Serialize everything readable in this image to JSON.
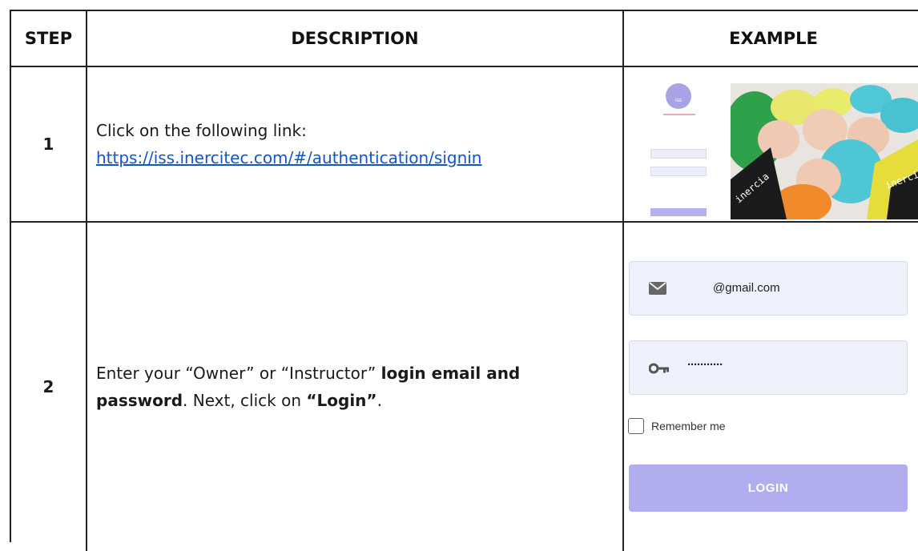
{
  "headers": {
    "step": "STEP",
    "description": "DESCRIPTION",
    "example": "EXAMPLE"
  },
  "rows": [
    {
      "step": "1",
      "text_before": "Click on the following link:",
      "link": "https://iss.inercitec.com/#/authentication/signin",
      "example_thumb": {
        "logo_text": "iss",
        "photo_caption": "inercia i.d.s"
      }
    },
    {
      "step": "2",
      "text_a": "Enter your “Owner” or “Instructor” ",
      "text_bold": "login email and password",
      "text_b": ". Next, click on ",
      "text_bold2": "“Login”",
      "text_c": ".",
      "example_form": {
        "email_value": "@gmail.com",
        "password_value": "···········",
        "remember_label": "Remember me",
        "login_label": "LOGIN",
        "email_icon": "envelope-icon",
        "password_icon": "key-icon"
      }
    }
  ],
  "colors": {
    "accent": "#b1aef0",
    "field_bg": "#eef1fb",
    "link": "#1155cc"
  }
}
